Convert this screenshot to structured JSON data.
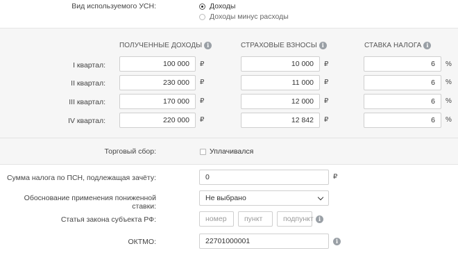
{
  "usn_type": {
    "label": "Вид используемого УСН:",
    "options": [
      {
        "label": "Доходы",
        "selected": true
      },
      {
        "label": "Доходы минус расходы",
        "selected": false
      }
    ]
  },
  "quarters": {
    "headers": {
      "income": "ПОЛУЧЕННЫЕ ДОХОДЫ",
      "contributions": "СТРАХОВЫЕ ВЗНОСЫ",
      "rate": "СТАВКА НАЛОГА"
    },
    "currency": "₽",
    "percent": "%",
    "rows": [
      {
        "label": "I квартал:",
        "income": "100 000",
        "contributions": "10 000",
        "rate": "6"
      },
      {
        "label": "II квартал:",
        "income": "230 000",
        "contributions": "11 000",
        "rate": "6"
      },
      {
        "label": "III квартал:",
        "income": "170 000",
        "contributions": "12 000",
        "rate": "6"
      },
      {
        "label": "IV квартал:",
        "income": "220 000",
        "contributions": "12 842",
        "rate": "6"
      }
    ]
  },
  "trade_fee": {
    "label": "Торговый сбор:",
    "checkbox_label": "Уплачивался",
    "checked": false
  },
  "psn": {
    "label": "Сумма налога по ПСН, подлежащая зачёту:",
    "value": "0",
    "currency": "₽"
  },
  "reduced_rate": {
    "label": "Обоснование применения пониженной ставки:",
    "selected": "Не выбрано"
  },
  "law_article": {
    "label": "Статья закона субъекта РФ:",
    "placeholders": {
      "number": "номер",
      "point": "пункт",
      "subpoint": "подпункт"
    }
  },
  "oktmo": {
    "label": "ОКТМО:",
    "value": "22701000001"
  },
  "icons": {
    "info": "info-icon",
    "dropdown": "chevron-down-icon",
    "radio": "radio-icon",
    "checkbox": "checkbox-icon"
  }
}
